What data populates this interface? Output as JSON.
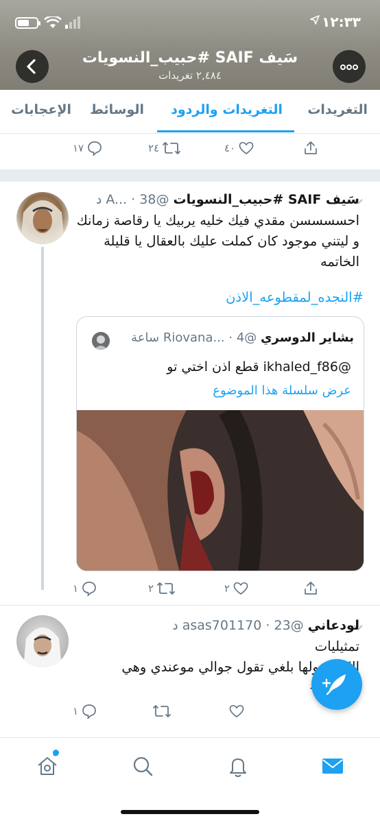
{
  "status_bar": {
    "time": "١٢:٣٣"
  },
  "header": {
    "title": "سَيف SAIF #حبيب_النسويات",
    "subtitle": "٢,٤٨٤ تغريدات"
  },
  "tabs": [
    {
      "label": "التغريدات",
      "active": false
    },
    {
      "label": "التغريدات والردود",
      "active": true
    },
    {
      "label": "الوسائط",
      "active": false
    },
    {
      "label": "الإعجابات",
      "active": false
    }
  ],
  "top_actions": {
    "reply_count": "١٧",
    "retweet_count": "٢٤",
    "like_count": "٤٠"
  },
  "tweet1": {
    "name": "سَيف SAIF #حبيب_النسويات",
    "handle": "@A...",
    "time": "38 د",
    "text": "احسسسسن مقدي فيك خليه يربيك يا رقاصة زمانك و ليتني موجود كان كملت عليك بالعقال يا قليلة الخاتمه",
    "hashtag": "#النجده_لمقطوعه_الاذن",
    "quote": {
      "name": "بشاير الدوسري",
      "handle": "@Riovana...",
      "time": "4 ساعة",
      "text": "@ikhaled_f86 قطع اذن اختي تو",
      "link": "عرض سلسلة هذا الموضوع"
    },
    "reply_count": "١",
    "retweet_count": "٢",
    "like_count": "٢"
  },
  "tweet2": {
    "name": "لودعاني",
    "handle": "@asas701170",
    "time": "23 د",
    "text": "تمثيليات\nالكل يقولها بلغي تقول جوالي موعندي وهي\nمنكية 😂",
    "reply_count": "١"
  },
  "colors": {
    "accent": "#1da1f2",
    "muted": "#657786",
    "border": "#e1e8ed"
  },
  "icons": [
    "back-arrow-icon",
    "more-icon",
    "reply-icon",
    "retweet-icon",
    "like-icon",
    "share-icon",
    "compose-icon",
    "home-icon",
    "search-icon",
    "notifications-icon",
    "messages-icon"
  ]
}
